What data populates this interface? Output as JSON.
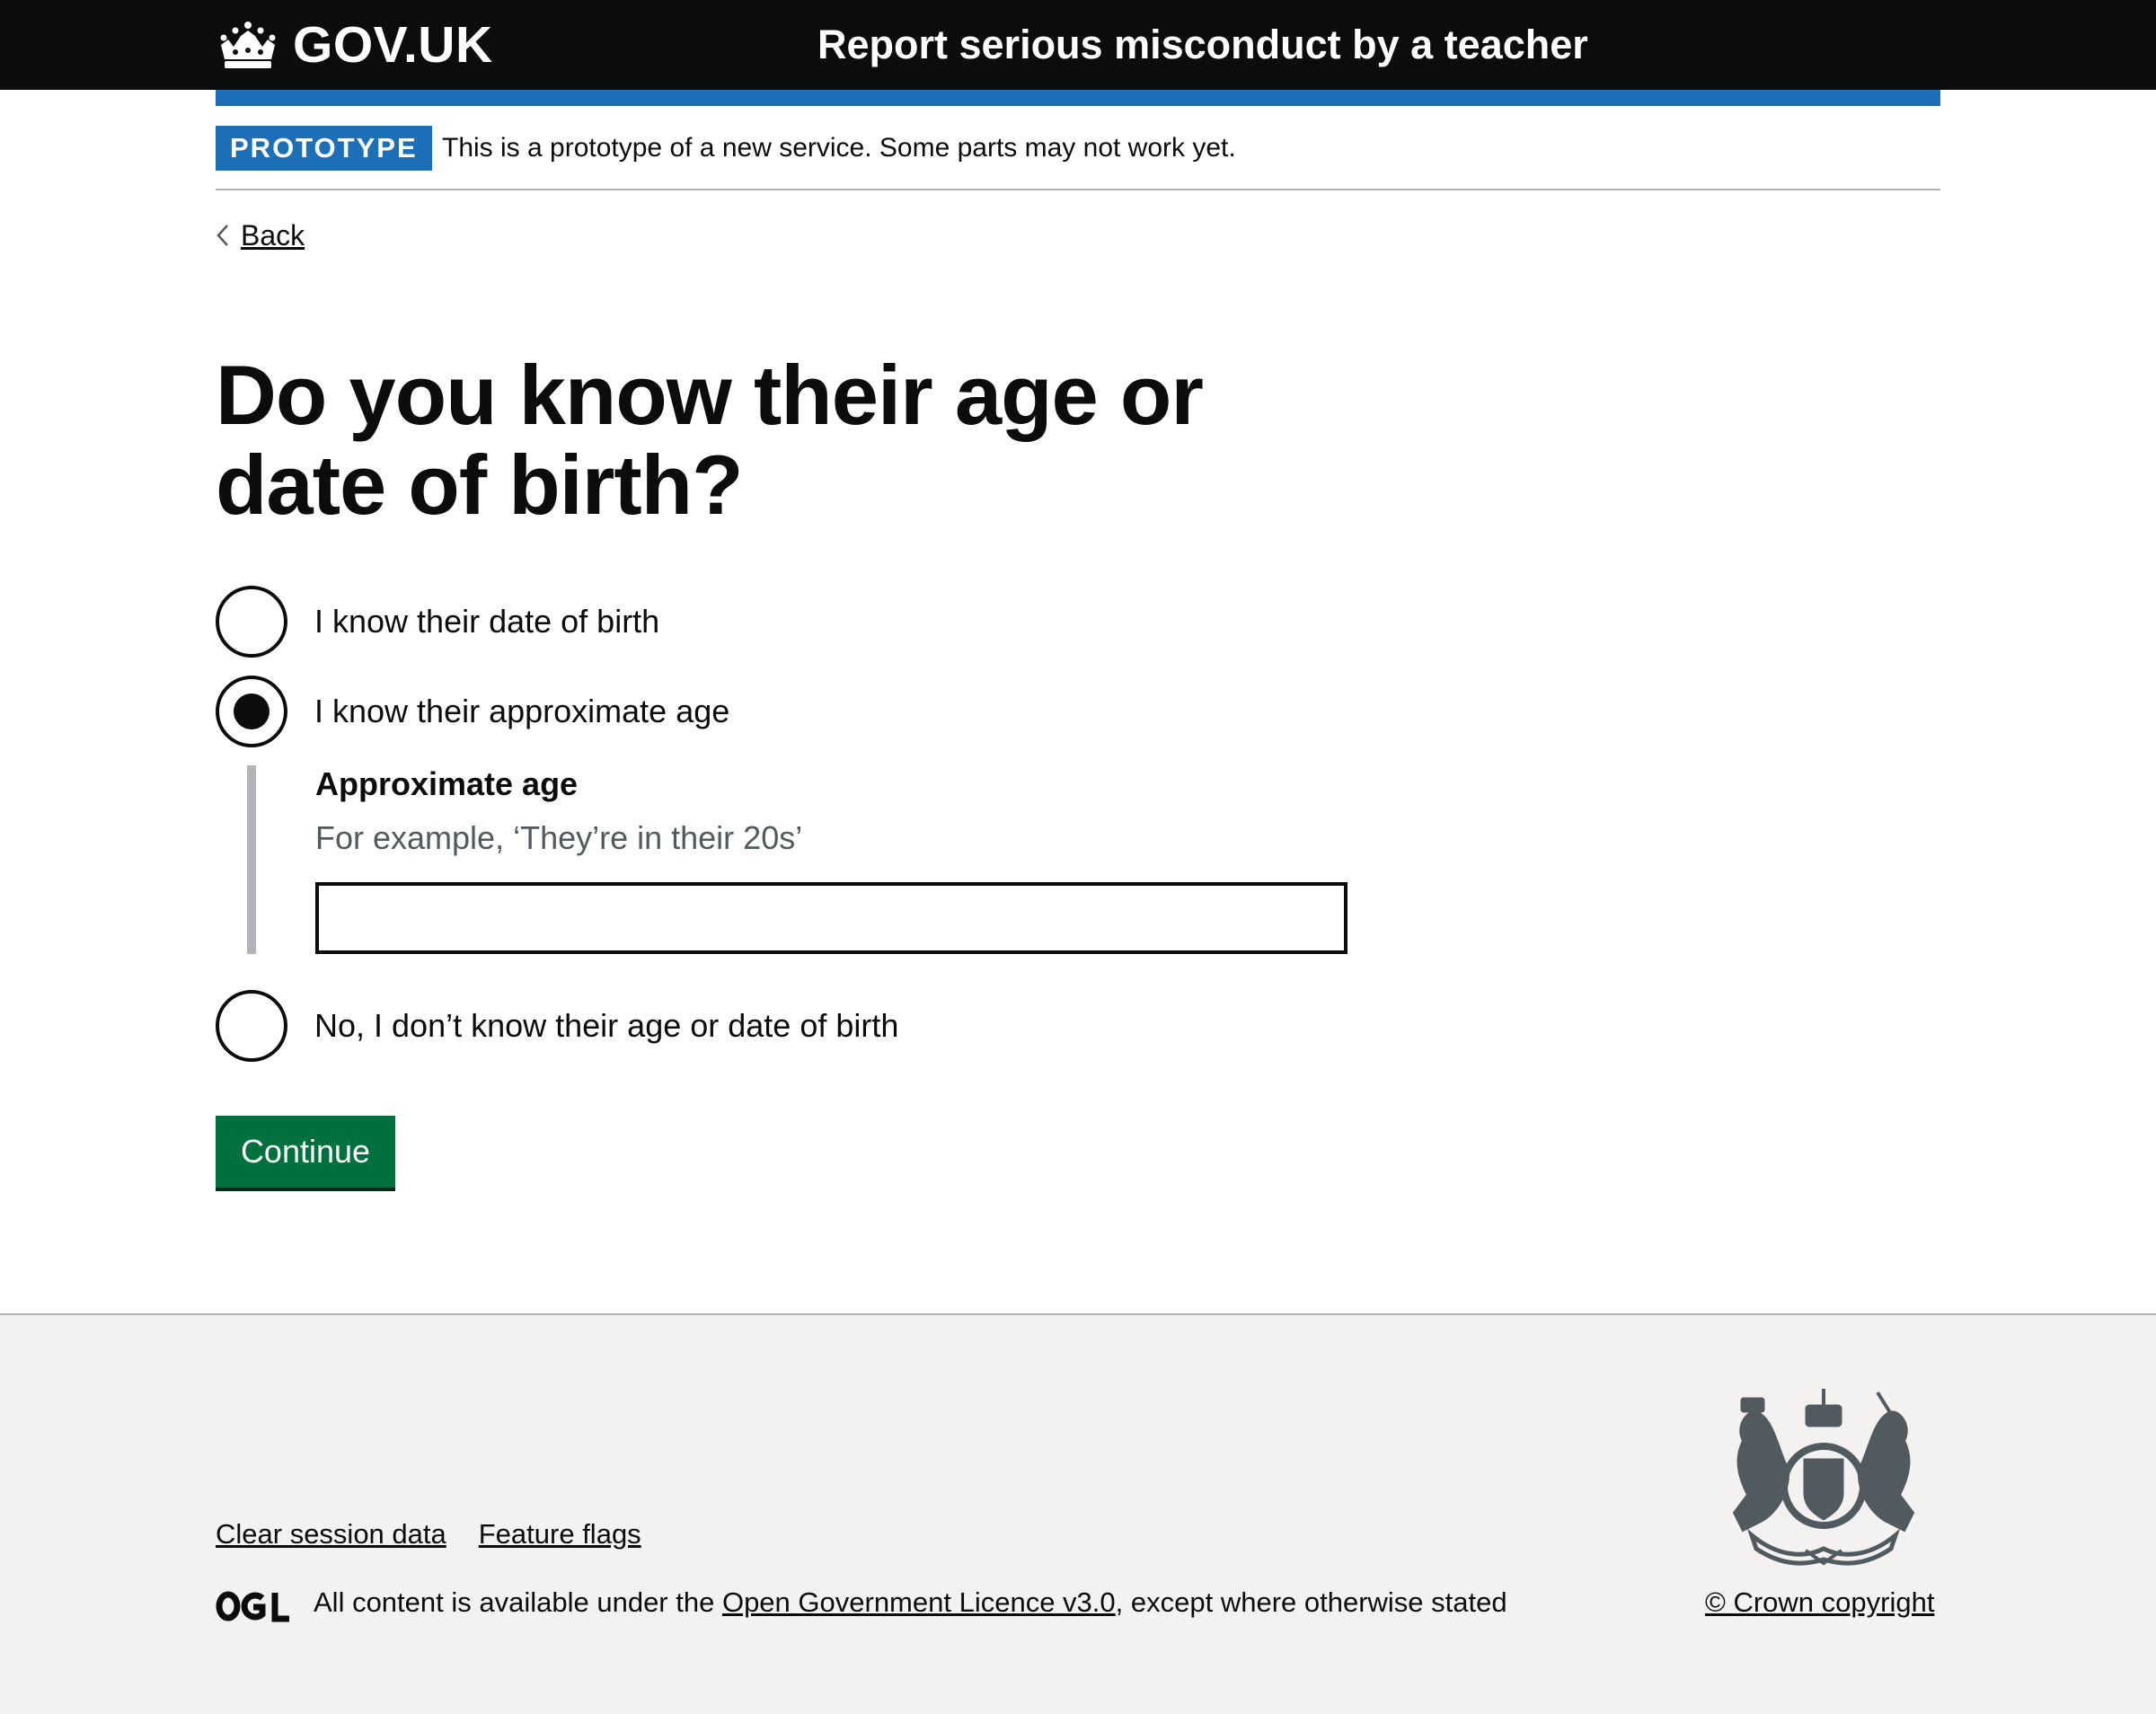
{
  "header": {
    "logo_text": "GOV.UK",
    "service_name": "Report serious misconduct by a teacher"
  },
  "phase_banner": {
    "tag": "PROTOTYPE",
    "text": "This is a prototype of a new service. Some parts may not work yet."
  },
  "back_link": "Back",
  "question": {
    "heading_line1": "Do you know their age or",
    "heading_line2": "date of birth?",
    "options": [
      {
        "label": "I know their date of birth",
        "checked": false
      },
      {
        "label": "I know their approximate age",
        "checked": true
      },
      {
        "label": "No, I don’t know their age or date of birth",
        "checked": false
      }
    ],
    "conditional": {
      "label": "Approximate age",
      "hint": "For example, ‘They’re in their 20s’",
      "value": ""
    }
  },
  "continue_label": "Continue",
  "footer": {
    "links": [
      "Clear session data",
      "Feature flags"
    ],
    "licence_prefix": "All content is available under the ",
    "licence_link": "Open Government Licence v3.0",
    "licence_suffix": ", except where otherwise stated",
    "copyright": "© Crown copyright"
  },
  "colors": {
    "header_bg": "#0b0c0c",
    "brand_blue": "#1d70b8",
    "button_green": "#00703c",
    "footer_bg": "#f3f2f1",
    "hint_grey": "#505a5f"
  }
}
